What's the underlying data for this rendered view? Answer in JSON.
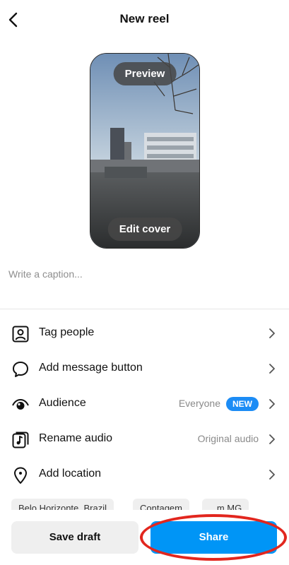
{
  "header": {
    "title": "New reel",
    "back_icon": "chevron-left-icon"
  },
  "preview": {
    "preview_label": "Preview",
    "edit_cover_label": "Edit cover"
  },
  "caption": {
    "placeholder": "Write a caption..."
  },
  "options": [
    {
      "label": "Tag people",
      "icon": "tag-person-icon"
    },
    {
      "label": "Add message button",
      "icon": "message-bubble-icon"
    },
    {
      "label": "Audience",
      "icon": "eye-icon",
      "value": "Everyone",
      "badge": "NEW"
    },
    {
      "label": "Rename audio",
      "icon": "audio-note-icon",
      "value": "Original audio"
    },
    {
      "label": "Add location",
      "icon": "location-pin-icon"
    }
  ],
  "location_suggestions": [
    "Belo Horizonte, Brazil",
    "Contagem",
    "...m MG"
  ],
  "footer": {
    "save_draft_label": "Save draft",
    "share_label": "Share"
  },
  "colors": {
    "share_blue": "#0095f6",
    "badge_blue": "#1c8cf5",
    "annotation_red": "#e2261e"
  }
}
